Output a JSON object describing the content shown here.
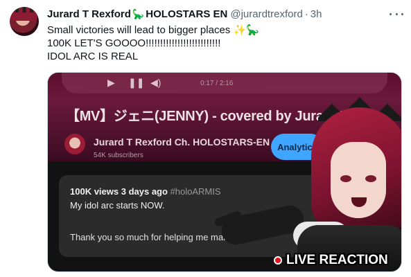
{
  "tweet": {
    "display_name": "Jurard T Rexford",
    "name_emoji": "🦕",
    "name_suffix": "HOLOSTARS EN",
    "handle": "@jurardtrexford",
    "separator": "·",
    "time": "3h",
    "lines": [
      "Small victories will lead to bigger places",
      "100K LET'S GOOOO!!!!!!!!!!!!!!!!!!!!!!!!!!",
      "IDOL ARC IS REAL"
    ],
    "line1_emojis": "✨🦕"
  },
  "media": {
    "timecode": "0:17 / 2:16",
    "video_title": "【MV】ジェニ(JENNY) - covered by Jurard T Rex",
    "channel_name": "Jurard T Rexford Ch. HOLOSTARS-EN",
    "subscribers": "54K subscribers",
    "analytics_label": "Analytics",
    "description": {
      "views": "100K views",
      "age": "3 days ago",
      "hashtag": "#holoARMIS",
      "line1": "My idol arc starts NOW.",
      "line2": "Thank you so much for helping me make"
    },
    "overlay_label": "LIVE REACTION"
  },
  "colors": {
    "accent": "#3ea6ff",
    "live_dot": "#e0141f",
    "muted": "#536471"
  }
}
